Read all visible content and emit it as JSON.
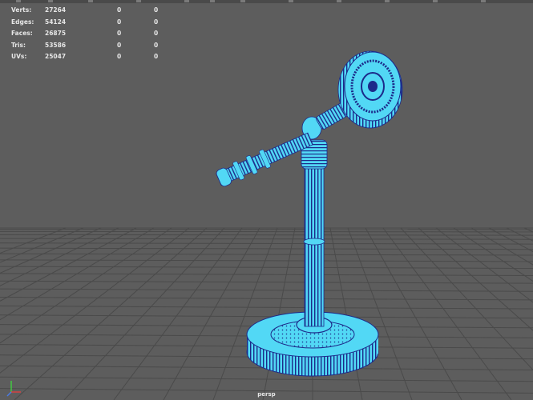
{
  "heads_up_display": {
    "rows": [
      {
        "label": "Verts:",
        "value": "27264",
        "selected": "0",
        "uv": "0"
      },
      {
        "label": "Edges:",
        "value": "54124",
        "selected": "0",
        "uv": "0"
      },
      {
        "label": "Faces:",
        "value": "26875",
        "selected": "0",
        "uv": "0"
      },
      {
        "label": "Tris:",
        "value": "53586",
        "selected": "0",
        "uv": "0"
      },
      {
        "label": "UVs:",
        "value": "25047",
        "selected": "0",
        "uv": "0"
      }
    ]
  },
  "viewport": {
    "camera": "persp",
    "background_color": "#5d5d5d",
    "grid_color": "#4a4a4a",
    "wireframe_fill": "#52d8f5",
    "wireframe_line": "#1c2a8a"
  },
  "axis_gizmo": {
    "x_color": "#e04040",
    "y_color": "#40d040",
    "z_color": "#4a7ce8"
  }
}
